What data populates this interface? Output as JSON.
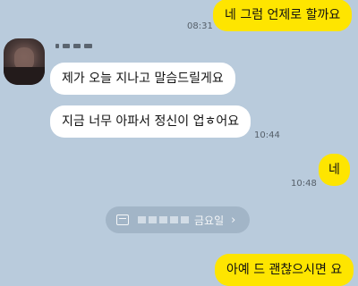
{
  "messages": {
    "sent_1": {
      "text": "네 그럼 언제로 할까요",
      "time": "08:31"
    },
    "received_1": {
      "text": "제가 오늘 지나고 말슴드릴게요"
    },
    "received_2": {
      "text": "지금 너무 아파서 정신이 업ㅎ어요",
      "time": "10:44"
    },
    "sent_2": {
      "text": "네",
      "time": "10:48"
    },
    "sent_3": {
      "text": "아예 드 괜찮으시면 요"
    }
  },
  "date_divider": {
    "label": "금요일",
    "chevron": "›"
  },
  "icons": [
    "calendar-icon",
    "chevron-right-icon"
  ],
  "colors": {
    "background": "#b9cbdc",
    "my_bubble": "#fee500",
    "other_bubble": "#ffffff"
  }
}
